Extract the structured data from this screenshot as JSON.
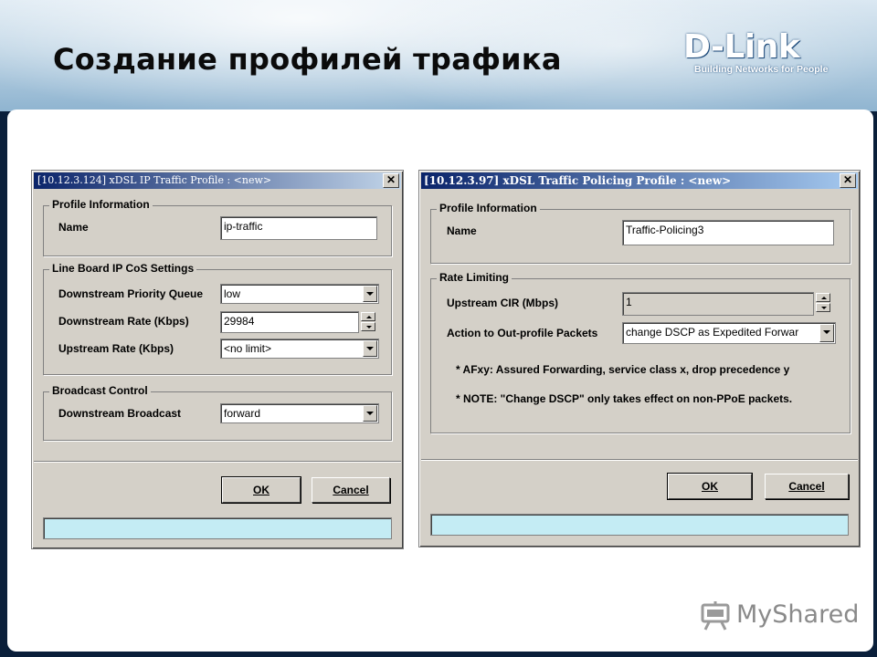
{
  "slide": {
    "title": "Создание профилей трафика",
    "logo_brand": "D-Link",
    "logo_tagline": "Building Networks for People",
    "watermark": "MyShared"
  },
  "dialog_left": {
    "title": "[10.12.3.124] xDSL IP Traffic Profile : <new>",
    "close": "✕",
    "profile_group": "Profile Information",
    "name_label": "Name",
    "name_value": "ip-traffic",
    "cos_group": "Line Board IP CoS Settings",
    "ds_queue_label": "Downstream Priority Queue",
    "ds_queue_value": "low",
    "ds_rate_label": "Downstream Rate (Kbps)",
    "ds_rate_value": "29984",
    "us_rate_label": "Upstream Rate (Kbps)",
    "us_rate_value": "<no limit>",
    "bc_group": "Broadcast Control",
    "ds_broadcast_label": "Downstream Broadcast",
    "ds_broadcast_value": "forward",
    "ok": "OK",
    "cancel": "Cancel"
  },
  "dialog_right": {
    "title": "[10.12.3.97] xDSL Traffic Policing Profile : <new>",
    "close": "✕",
    "profile_group": "Profile Information",
    "name_label": "Name",
    "name_value": "Traffic-Policing3",
    "rate_group": "Rate Limiting",
    "us_cir_label": "Upstream CIR (Mbps)",
    "us_cir_value": "1",
    "action_label": "Action to Out-profile Packets",
    "action_value": "change DSCP as Expedited Forwar",
    "note1": "* AFxy: Assured Forwarding, service class x, drop precedence y",
    "note2": "* NOTE: \"Change DSCP\" only takes effect on non-PPoE packets.",
    "ok": "OK",
    "cancel": "Cancel"
  }
}
